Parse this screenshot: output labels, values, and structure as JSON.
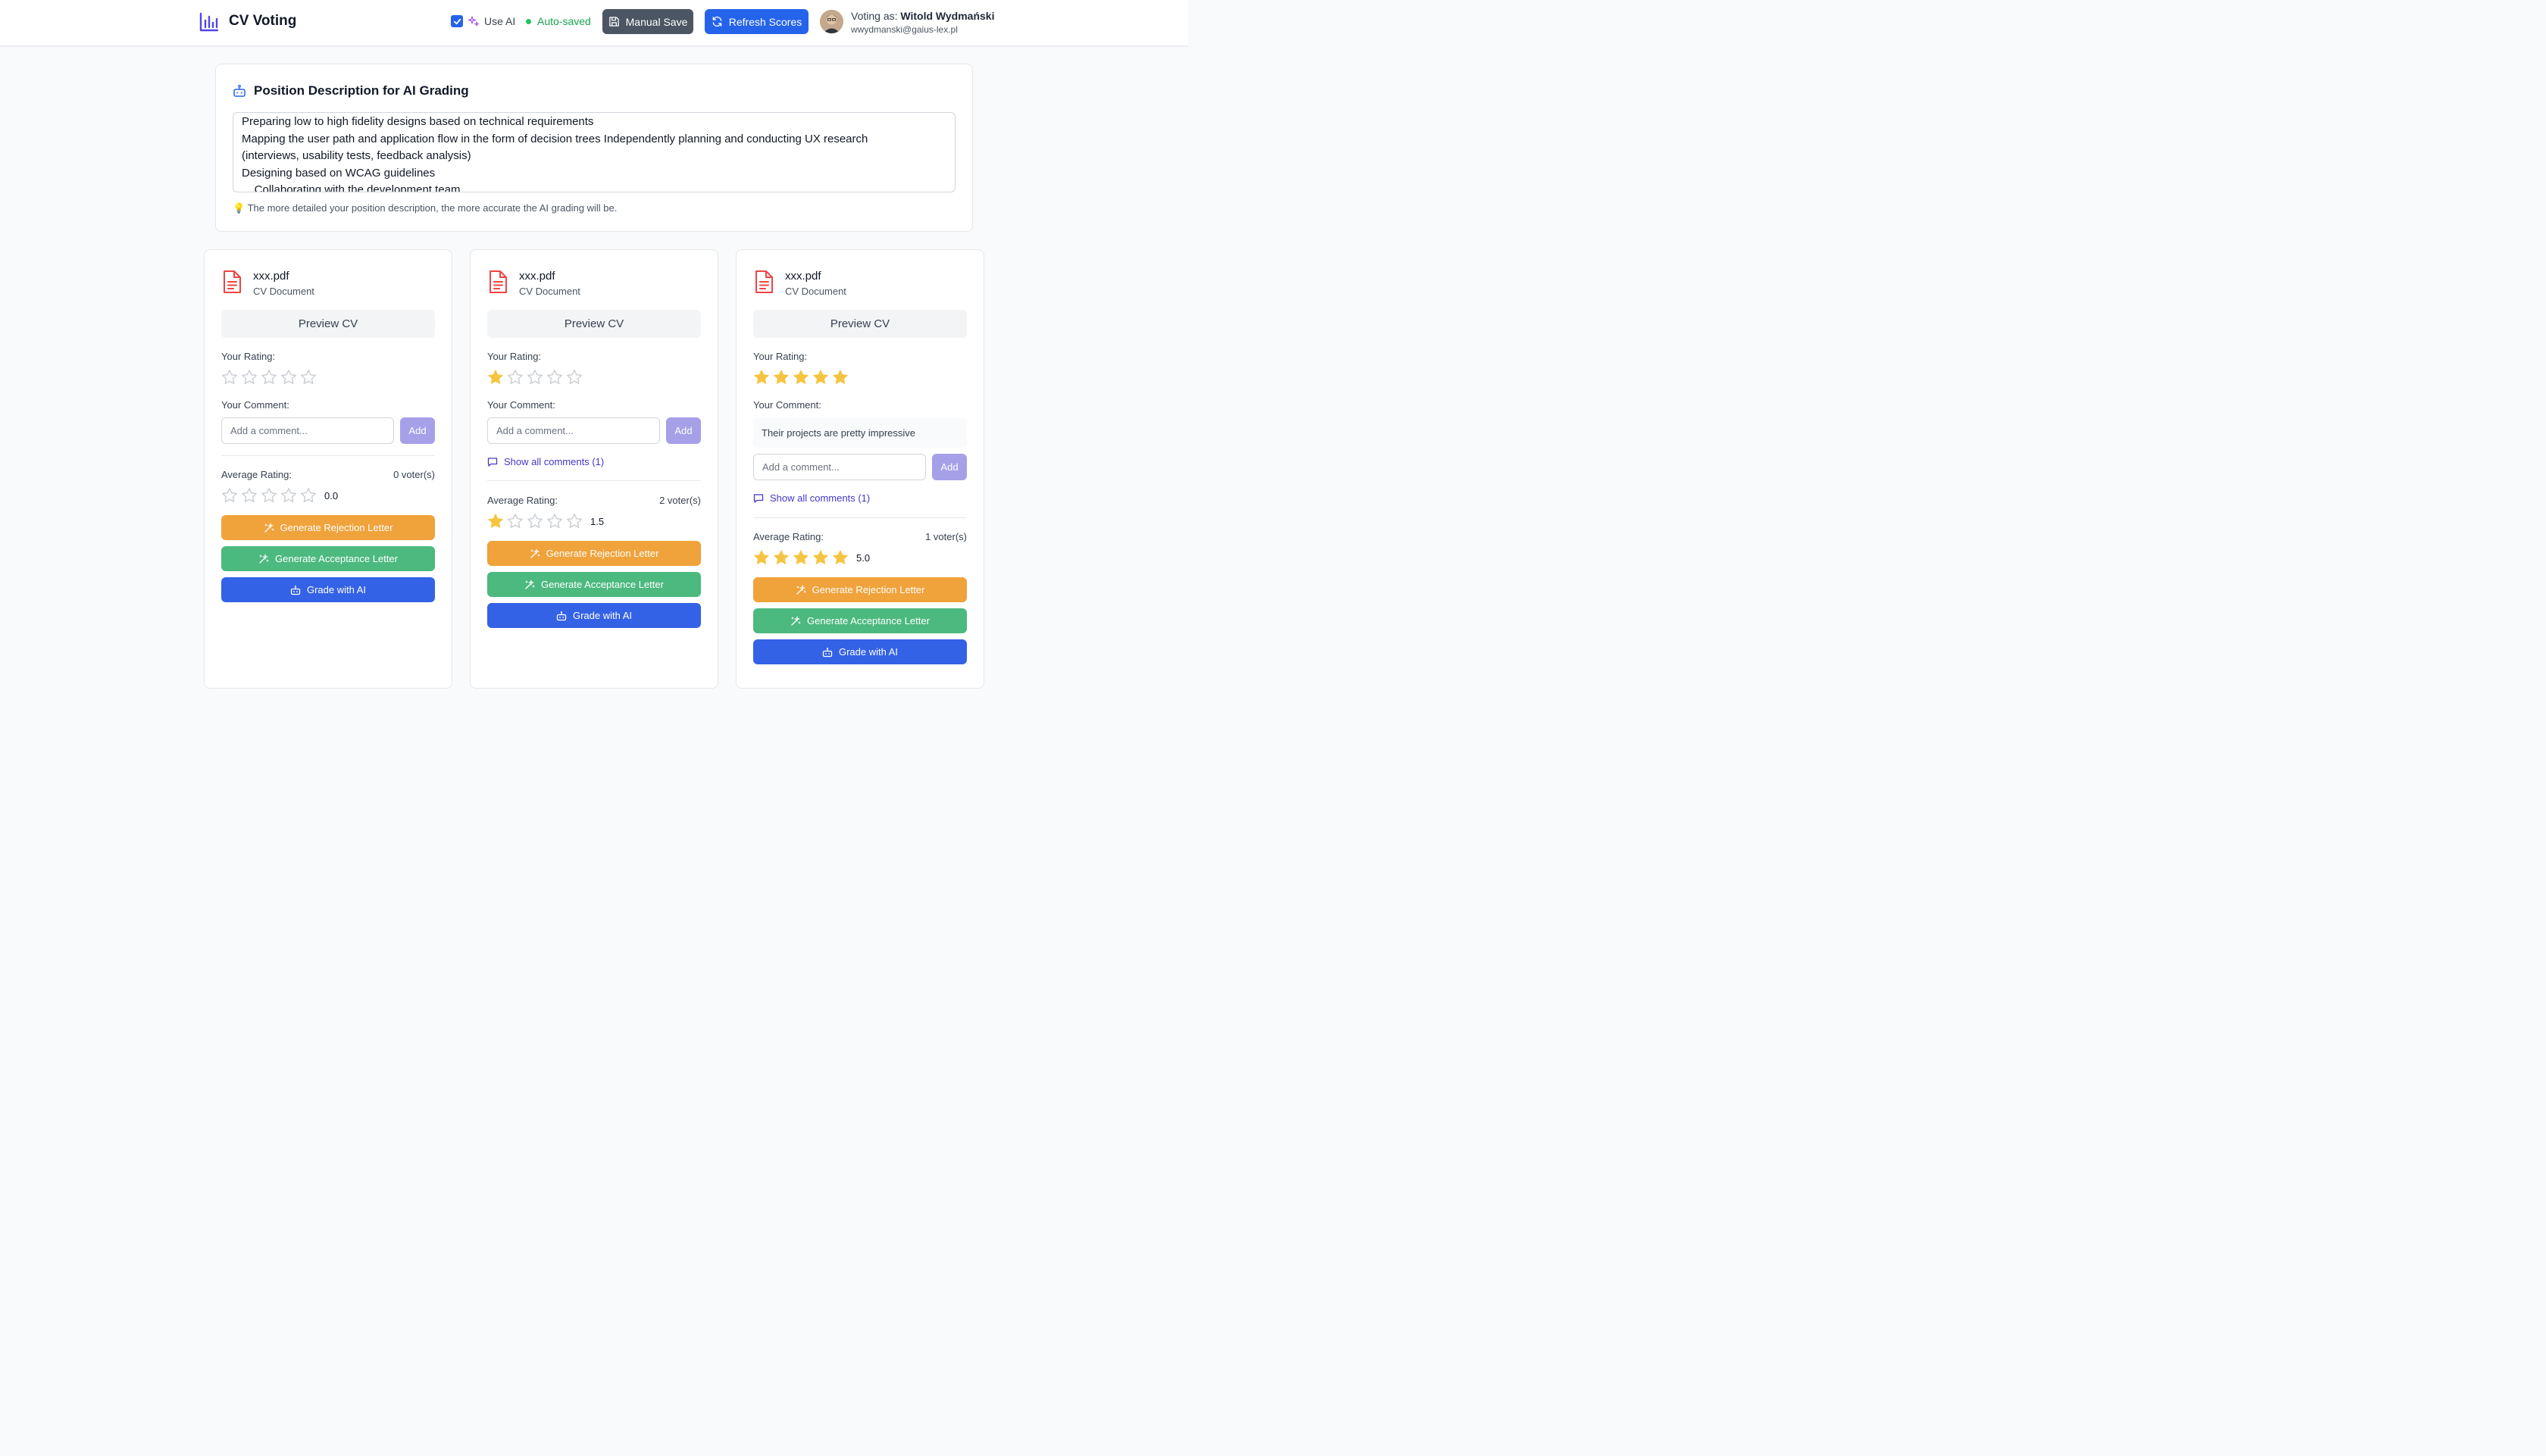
{
  "header": {
    "app_title": "CV Voting",
    "use_ai_label": "Use AI",
    "use_ai_checked": true,
    "autosaved_label": "Auto-saved",
    "manual_save_label": "Manual Save",
    "refresh_label": "Refresh Scores",
    "voting_as_prefix": "Voting as:",
    "user_name": "Witold Wydmański",
    "user_email": "wwydmanski@gaius-lex.pl"
  },
  "position": {
    "title": "Position Description for AI Grading",
    "lines": [
      "Preparing low to high fidelity designs based on technical requirements",
      "Mapping the user path and application flow in the form of decision trees Independently planning and conducting UX research",
      "(interviews, usability tests, feedback analysis)",
      "Designing based on WCAG guidelines",
      "    Collaborating with the development team"
    ],
    "hint": "💡 The more detailed your position description, the more accurate the AI grading will be."
  },
  "common": {
    "cv_subtitle": "CV Document",
    "preview_label": "Preview CV",
    "your_rating_label": "Your Rating:",
    "your_comment_label": "Your Comment:",
    "comment_placeholder": "Add a comment...",
    "add_label": "Add",
    "average_label": "Average Rating:",
    "reject_label": "Generate Rejection Letter",
    "accept_label": "Generate Acceptance Letter",
    "grade_label": "Grade with AI"
  },
  "cards": [
    {
      "file_name": "xxx.pdf",
      "your_rating": 0,
      "comment": "",
      "show_comments_label": "",
      "voters_label": "0 voter(s)",
      "average_value": "0.0",
      "average_stars": 0
    },
    {
      "file_name": "xxx.pdf",
      "your_rating": 1,
      "comment": "",
      "show_comments_label": "Show all comments (1)",
      "voters_label": "2 voter(s)",
      "average_value": "1.5",
      "average_stars": 1
    },
    {
      "file_name": "xxx.pdf",
      "your_rating": 5,
      "comment": "Their projects are pretty impressive",
      "show_comments_label": "Show all comments (1)",
      "voters_label": "1 voter(s)",
      "average_value": "5.0",
      "average_stars": 5
    }
  ],
  "colors": {
    "star_filled": "#f5c542",
    "star_empty": "#c9cdd3",
    "primary": "#2563eb",
    "reject": "#f0a23b",
    "accept": "#4cb97f",
    "grade": "#3462e6"
  }
}
